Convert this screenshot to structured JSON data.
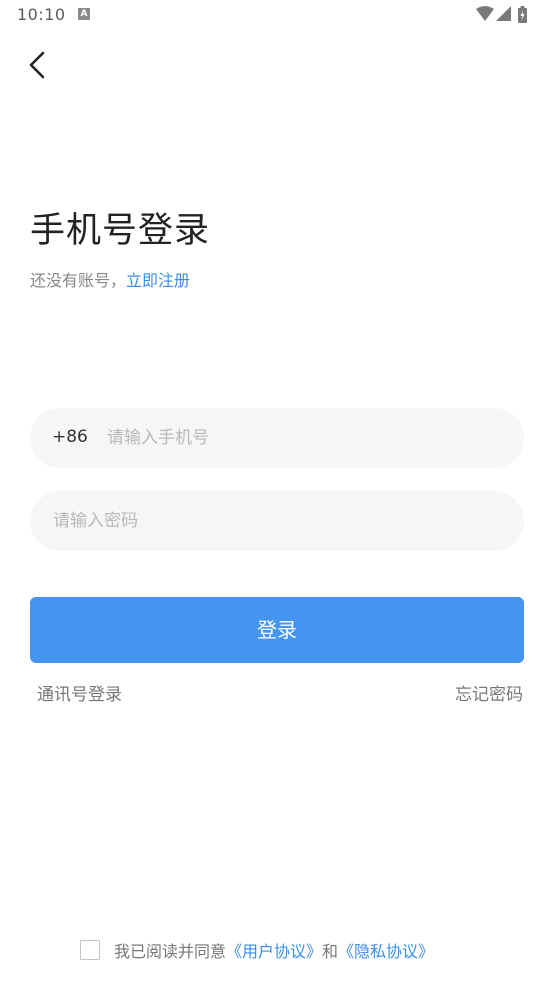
{
  "status_bar": {
    "time": "10:10",
    "notification_icon": "a-icon",
    "icons": [
      "wifi-icon",
      "signal-icon",
      "battery-icon"
    ]
  },
  "header": {
    "back_icon": "chevron-left-icon"
  },
  "title": "手机号登录",
  "subtitle": {
    "prefix": "还没有账号，",
    "link": "立即注册"
  },
  "phone_field": {
    "country_code": "+86",
    "value": "",
    "placeholder": "请输入手机号"
  },
  "password_field": {
    "value": "",
    "placeholder": "请输入密码"
  },
  "login_button": "登录",
  "links": {
    "alt_login": "通讯号登录",
    "forgot_password": "忘记密码"
  },
  "agreement": {
    "checked": false,
    "prefix": "我已阅读并同意",
    "user_agreement": "《用户协议》",
    "and": "和",
    "privacy_policy": "《隐私协议》"
  },
  "colors": {
    "accent": "#4395f0",
    "link": "#3a8ee6",
    "field_bg": "#f5f7f6"
  }
}
